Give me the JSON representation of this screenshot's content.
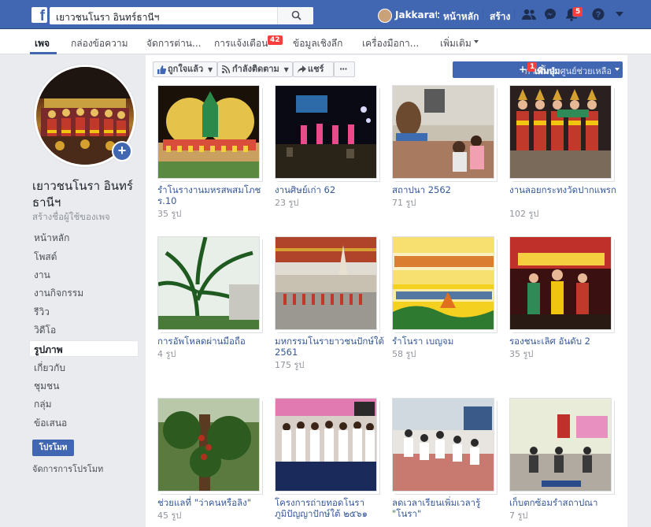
{
  "topbar": {
    "search_value": "เยาวชนโนรา อินทร์ธานีฯ",
    "user_name": "Jakkarat",
    "home_label": "หน้าหลัก",
    "create_label": "สร้าง",
    "notifications_count": "5",
    "brand_color": "#4267b2"
  },
  "page_nav": {
    "tabs": [
      {
        "label": "เพจ"
      },
      {
        "label": "กล่องข้อความ"
      },
      {
        "label": "จัดการต่าน..."
      },
      {
        "label": "การแจ้งเตือน"
      },
      {
        "label": "ข้อมูลเชิงลึก"
      },
      {
        "label": "เครื่องมือกา..."
      },
      {
        "label": "เพิ่มเติม"
      }
    ],
    "notifications_badge": "42"
  },
  "sidebar": {
    "page_name": "เยาวชนโนรา อินทร์ธานีฯ",
    "create_username": "สร้างชื่อผู้ใช้ของเพจ",
    "items": [
      {
        "label": "หน้าหลัก"
      },
      {
        "label": "โพสต์"
      },
      {
        "label": "งาน"
      },
      {
        "label": "งานกิจกรรม"
      },
      {
        "label": "รีวิว"
      },
      {
        "label": "วิดีโอ"
      },
      {
        "label": "รูปภาพ"
      },
      {
        "label": "เกี่ยวกับ"
      },
      {
        "label": "ชุมชน"
      },
      {
        "label": "กลุ่ม"
      },
      {
        "label": "ข้อเสนอ"
      }
    ],
    "promote_label": "โปรโมท",
    "manage_promotions": "จัดการการโปรโมท"
  },
  "action_bar": {
    "like_label": "ถูกใจแล้ว",
    "follow_label": "กำลังติดตาม",
    "share_label": "แชร์",
    "more_label": "···",
    "blue_text": "การตั้งค่าศูนย์ช่วยเหลือ",
    "blue_badge": "1",
    "blue_label": "เพิ่มปุ่ม"
  },
  "albums": [
    {
      "title": "รำโนรางานมหรสพสมโภช ร.10",
      "count": "35 รูป"
    },
    {
      "title": "งานศิษย์เก่า 62",
      "count": "23 รูป"
    },
    {
      "title": "สถาปนา 2562",
      "count": "71 รูป"
    },
    {
      "title": "งานลอยกระทงวัดปากแพรก",
      "count": "102 รูป"
    },
    {
      "title": "การอัพโหลดผ่านมือถือ",
      "count": "4 รูป"
    },
    {
      "title": "มหกรรมโนรายาวชนปักษ์ใต้ 2561",
      "count": "175 รูป"
    },
    {
      "title": "รำโนรา เบญจม",
      "count": "58 รูป"
    },
    {
      "title": "รองชนะเลิศ อันดับ 2",
      "count": "35 รูป"
    },
    {
      "title": "ช่วยแลที่ \"ว่าคนหรือลิง\"",
      "count": "45 รูป"
    },
    {
      "title": "โครงการถ่ายทอดโนราภูมิปัญญาปักษ์ใต้ ๒๕๖๑",
      "count": ""
    },
    {
      "title": "ลดเวลาเรียนเพิ่มเวลารู้ \"โนรา\"",
      "count": ""
    },
    {
      "title": "เก็บตกซ้อมรำสถาปณา",
      "count": "7 รูป"
    }
  ]
}
